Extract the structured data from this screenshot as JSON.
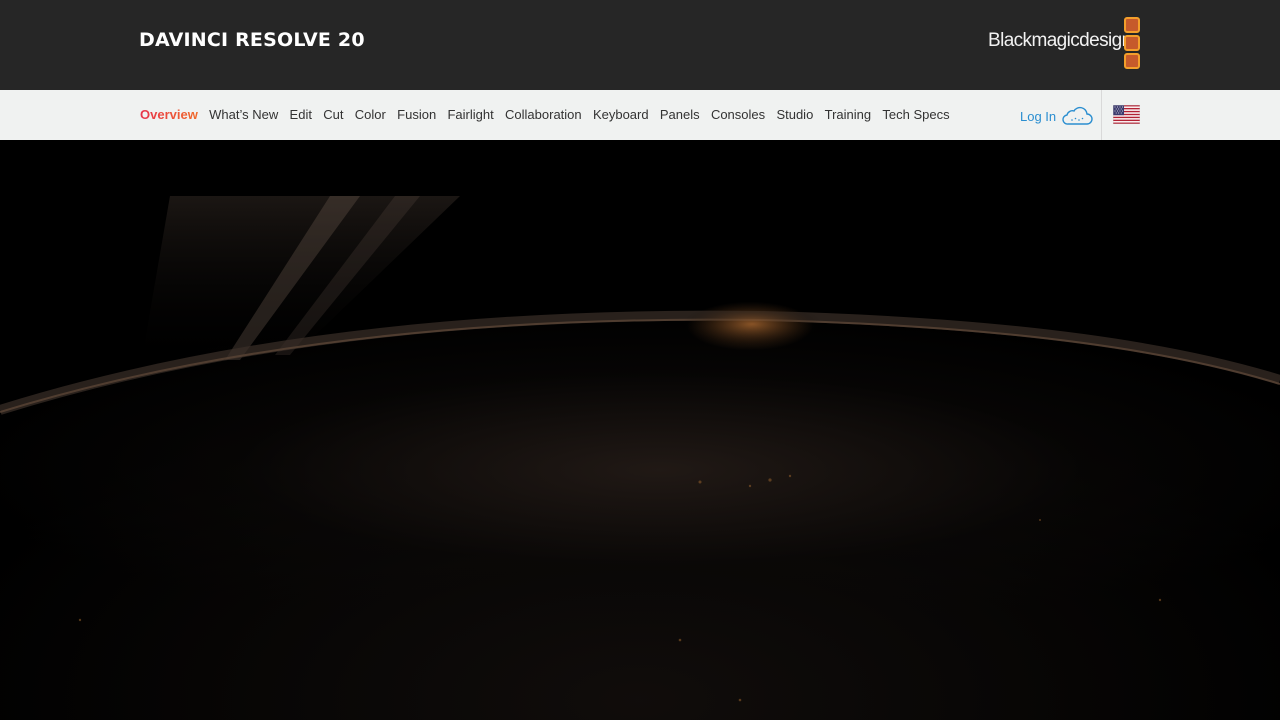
{
  "header": {
    "product_title": "DAVINCI RESOLVE 20",
    "brand_logo": {
      "wordmark": "Blackmagicdesign",
      "squares_color": "#f39f2b",
      "squares_fill": "#c65a2b"
    }
  },
  "nav": {
    "items": [
      {
        "label": "Overview",
        "active": true
      },
      {
        "label": "What’s New"
      },
      {
        "label": "Edit"
      },
      {
        "label": "Cut"
      },
      {
        "label": "Color"
      },
      {
        "label": "Fusion"
      },
      {
        "label": "Fairlight"
      },
      {
        "label": "Collaboration"
      },
      {
        "label": "Keyboard"
      },
      {
        "label": "Panels"
      },
      {
        "label": "Consoles"
      },
      {
        "label": "Studio"
      },
      {
        "label": "Training"
      },
      {
        "label": "Tech Specs"
      }
    ],
    "login_label": "Log In",
    "login_icon": "cloud-icon",
    "region_icon": "us-flag-icon",
    "active_gradient": [
      "#e7344c",
      "#f06a2a"
    ],
    "link_color": "#2a8ed0"
  },
  "hero": {
    "description_icon": "earth-horizon-at-night-image"
  }
}
